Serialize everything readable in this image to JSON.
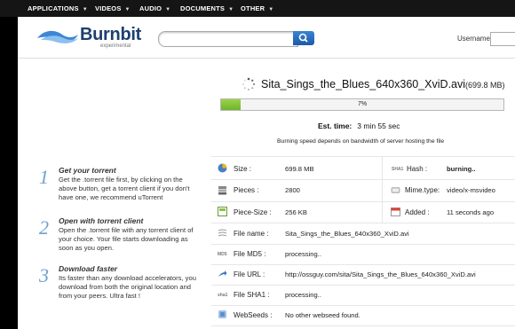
{
  "topnav": {
    "items": [
      {
        "label": "APPLICATIONS"
      },
      {
        "label": "VIDEOS"
      },
      {
        "label": "AUDIO"
      },
      {
        "label": "DOCUMENTS"
      },
      {
        "label": "OTHER"
      }
    ]
  },
  "header": {
    "logo": "Burnbit",
    "logo_sub": "experimental",
    "search_placeholder": "",
    "username_label": "Username"
  },
  "download": {
    "file_name": "Sita_Sings_the_Blues_640x360_XviD.avi",
    "file_size_display": "(699.8 MB)",
    "progress_percent": 7,
    "progress_label": "7%",
    "est_label": "Est. time:",
    "est_value": "3 min 55 sec",
    "note": "Burning speed depends on bandwidth of server hosting the file"
  },
  "steps": [
    {
      "num": "1",
      "title": "Get your torrent",
      "body": "Get the .torrent file first, by clicking on the above button, get a torrent client if you don't have one, we recommend uTorrent"
    },
    {
      "num": "2",
      "title": "Open with torrent client",
      "body": "Open the .torrent file with any torrent client of your choice. Your file starts downloading as soon as you open."
    },
    {
      "num": "3",
      "title": "Download faster",
      "body": "Its faster than any download accelerators, you download from both the original location and from your peers. Ultra fast !"
    }
  ],
  "details": {
    "size_label": "Size :",
    "size_value": "699.8 MB",
    "hash_label": "Hash :",
    "hash_value": "burning..",
    "pieces_label": "Pieces :",
    "pieces_value": "2800",
    "mime_label": "Mime.type:",
    "mime_value": "video/x-msvideo",
    "piece_size_label": "Piece-Size :",
    "piece_size_value": "256 KB",
    "added_label": "Added :",
    "added_value": "11 seconds ago",
    "file_name_label": "File name :",
    "file_name_value": "Sita_Sings_the_Blues_640x360_XviD.avi",
    "md5_label": "File MD5 :",
    "md5_value": "processing..",
    "url_label": "File URL :",
    "url_value": "http://ossguy.com/sita/Sita_Sings_the_Blues_640x360_XviD.avi",
    "sha1_label": "File SHA1 :",
    "sha1_value": "processing..",
    "webseeds_label": "WebSeeds :",
    "webseeds_value": "No other webseed found.",
    "md5_icon_text": "MD5",
    "sha1_icon_text": "sha1",
    "sha1_hash_icon_text": "SHA1"
  },
  "colors": {
    "accent": "#1d5aa6",
    "progress": "#7cc236",
    "nav_bg": "#151515"
  }
}
